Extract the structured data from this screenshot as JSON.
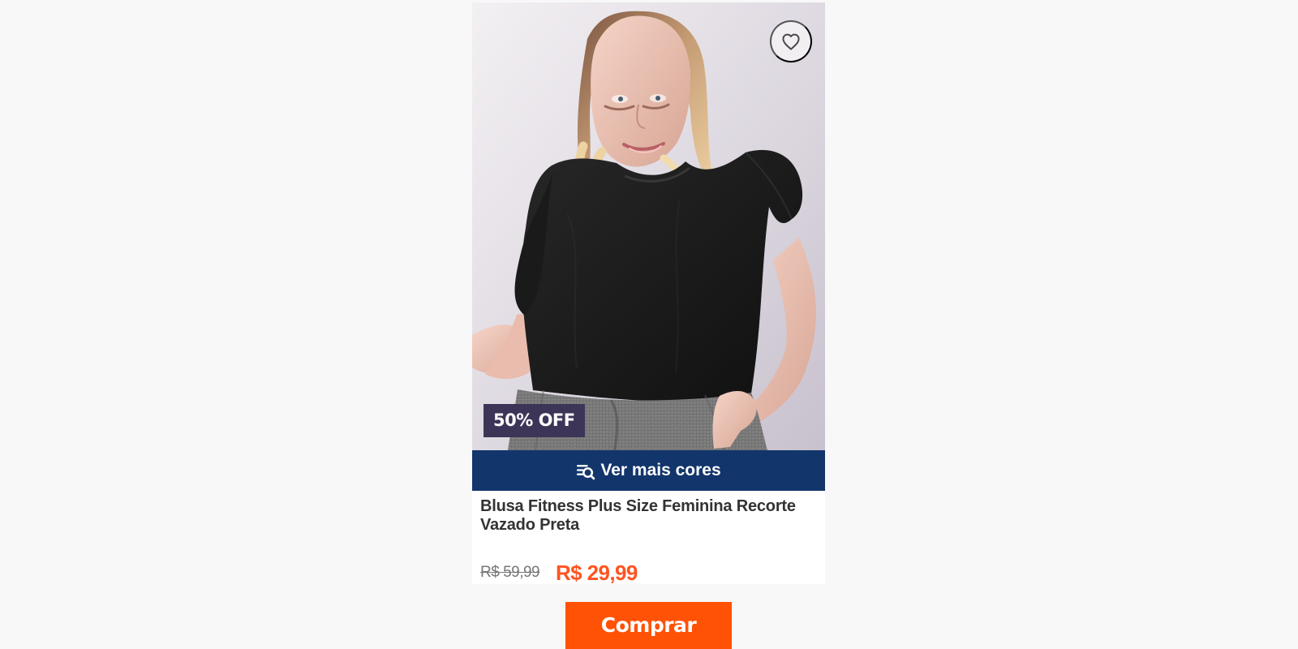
{
  "product": {
    "discount": "50% OFF",
    "colors_button": "Ver mais cores",
    "title": "Blusa Fitness Plus Size Feminina Recorte Vazado Preta",
    "old_price": "R$ 59,99",
    "price": "R$ 29,99",
    "buy_label": "Comprar"
  },
  "icons": {
    "favorite": "heart-outline-icon",
    "colors": "list-search-icon"
  },
  "colors": {
    "background": "#f8f8f8",
    "badge": "#3d3558",
    "colors_bar": "#12356b",
    "price": "#ff5421",
    "buy_button": "#ff5205"
  }
}
